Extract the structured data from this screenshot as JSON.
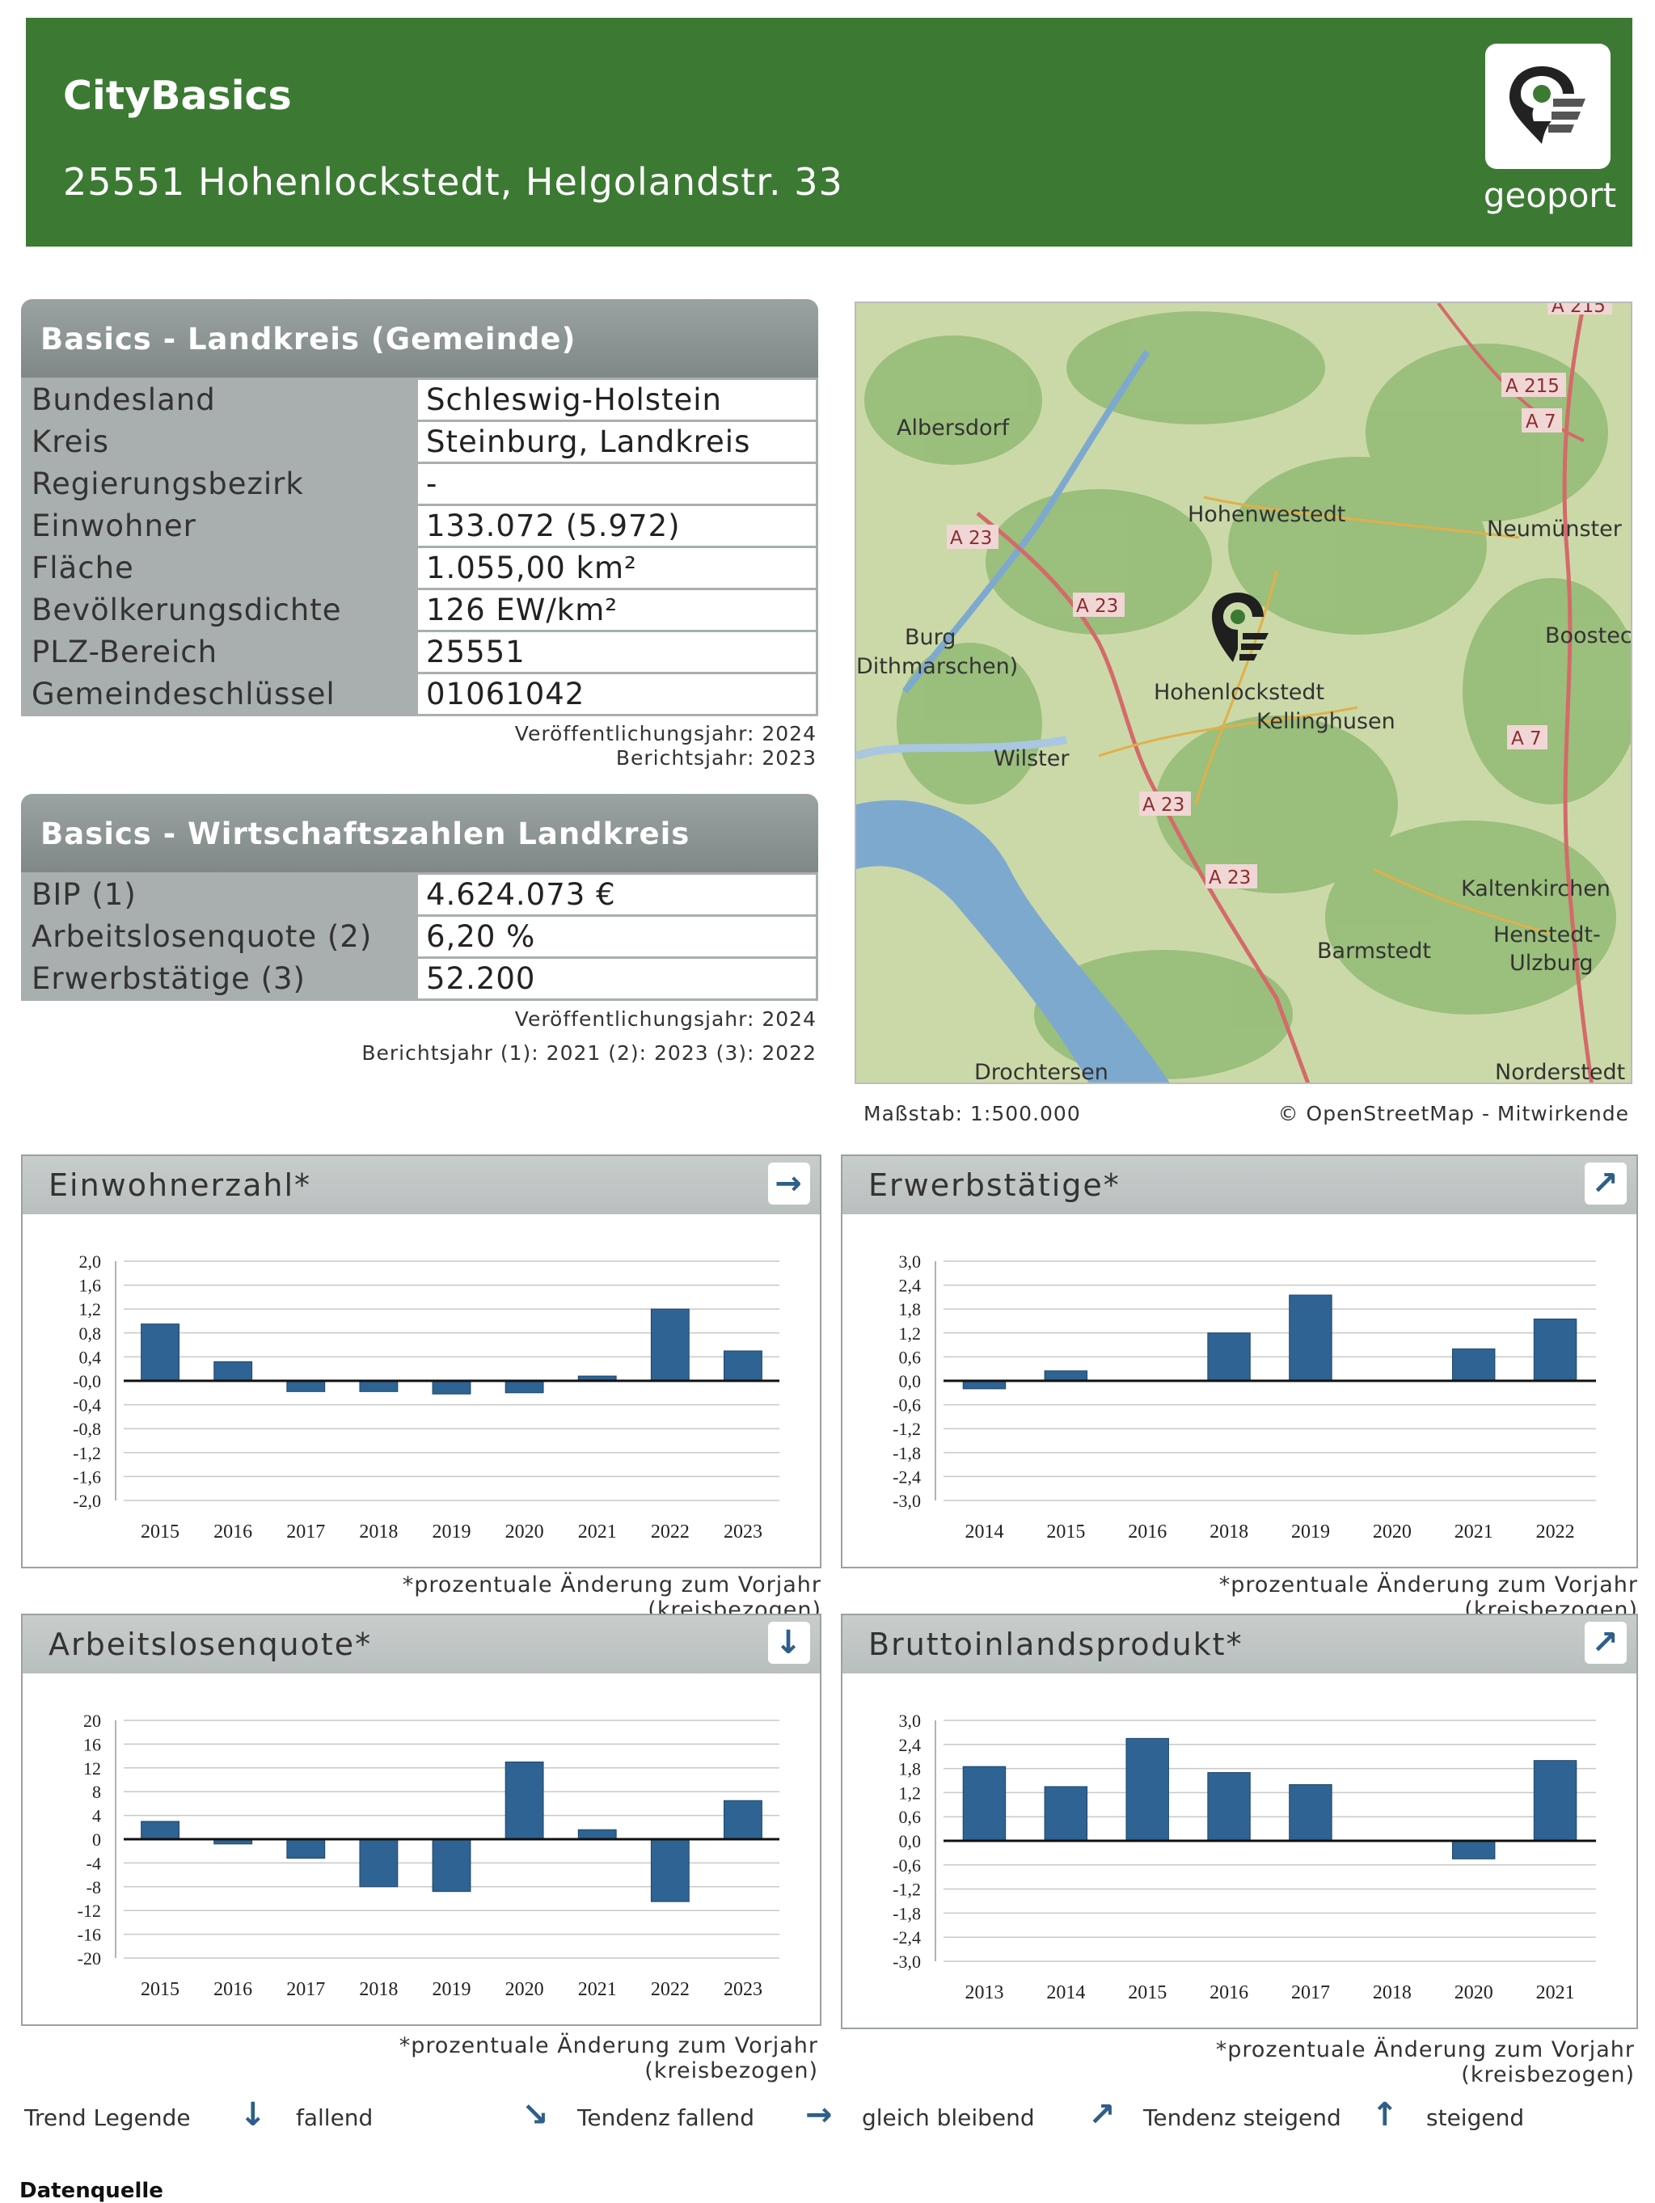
{
  "header": {
    "app_name": "CityBasics",
    "address": "25551 Hohenlockstedt, Helgolandstr. 33",
    "logo_text": "geoport"
  },
  "basics": {
    "title": "Basics - Landkreis (Gemeinde)",
    "rows": [
      {
        "label": "Bundesland",
        "value": "Schleswig-Holstein"
      },
      {
        "label": "Kreis",
        "value": "Steinburg, Landkreis"
      },
      {
        "label": "Regierungsbezirk",
        "value": "-"
      },
      {
        "label": "Einwohner",
        "value": "133.072 (5.972)"
      },
      {
        "label": "Fläche",
        "value": "1.055,00 km²"
      },
      {
        "label": "Bevölkerungsdichte",
        "value": "126 EW/km²"
      },
      {
        "label": "PLZ-Bereich",
        "value": "25551"
      },
      {
        "label": "Gemeindeschlüssel",
        "value": "01061042"
      }
    ],
    "pub_year": "Veröffentlichungsjahr: 2024",
    "report_year": "Berichtsjahr: 2023"
  },
  "economy": {
    "title": "Basics - Wirtschaftszahlen Landkreis",
    "rows": [
      {
        "label": "BIP (1)",
        "value": "4.624.073 €"
      },
      {
        "label": "Arbeitslosenquote (2)",
        "value": "6,20 %"
      },
      {
        "label": "Erwerbstätige (3)",
        "value": "52.200"
      }
    ],
    "pub_year": "Veröffentlichungsjahr: 2024",
    "report_year": "Berichtsjahr (1): 2021 (2): 2023 (3): 2022"
  },
  "map": {
    "places": [
      "Albersdorf",
      "Hohenwestedt",
      "Neumünster",
      "Burg",
      "Dithmarschen)",
      "Boostec",
      "Hohenlockstedt",
      "Kellinghusen",
      "Wilster",
      "Kaltenkirchen",
      "Henstedt-",
      "Ulzburg",
      "Barmstedt",
      "Drochtersen",
      "Norderstedt"
    ],
    "roads": [
      "A 215",
      "A 215",
      "A 7",
      "A 23",
      "A 23",
      "A 7",
      "A 23",
      "A 23"
    ],
    "scale": "Maßstab: 1:500.000",
    "attribution": "© OpenStreetMap - Mitwirkende"
  },
  "footnote": "*prozentuale Änderung zum Vorjahr (kreisbezogen)",
  "chart_data": [
    {
      "type": "bar",
      "title": "Einwohnerzahl*",
      "trend": "gleich bleibend",
      "trend_icon": "→",
      "categories": [
        "2015",
        "2016",
        "2017",
        "2018",
        "2019",
        "2020",
        "2021",
        "2022",
        "2023"
      ],
      "values": [
        0.95,
        0.32,
        -0.18,
        -0.18,
        -0.22,
        -0.2,
        0.08,
        1.2,
        0.5
      ],
      "yticks": [
        "2,0",
        "1,6",
        "1,2",
        "0,8",
        "0,4",
        "-0,0",
        "-0,4",
        "-0,8",
        "-1,2",
        "-1,6",
        "-2,0"
      ],
      "ylim": [
        -2.0,
        2.0
      ]
    },
    {
      "type": "bar",
      "title": "Erwerbstätige*",
      "trend": "Tendenz steigend",
      "trend_icon": "↗",
      "categories": [
        "2014",
        "2015",
        "2016",
        "2018",
        "2019",
        "2020",
        "2021",
        "2022"
      ],
      "values": [
        -0.2,
        0.25,
        0.0,
        1.2,
        2.15,
        0.0,
        0.8,
        1.55
      ],
      "yticks": [
        "3,0",
        "2,4",
        "1,8",
        "1,2",
        "0,6",
        "0,0",
        "-0,6",
        "-1,2",
        "-1,8",
        "-2,4",
        "-3,0"
      ],
      "ylim": [
        -3.0,
        3.0
      ]
    },
    {
      "type": "bar",
      "title": "Arbeitslosenquote*",
      "trend": "fallend",
      "trend_icon": "↓",
      "categories": [
        "2015",
        "2016",
        "2017",
        "2018",
        "2019",
        "2020",
        "2021",
        "2022",
        "2023"
      ],
      "values": [
        3.0,
        -0.8,
        -3.2,
        -8.0,
        -8.8,
        13.0,
        1.6,
        -10.5,
        6.5
      ],
      "yticks": [
        "20",
        "16",
        "12",
        "8",
        "4",
        "0",
        "-4",
        "-8",
        "-12",
        "-16",
        "-20"
      ],
      "ylim": [
        -20,
        20
      ]
    },
    {
      "type": "bar",
      "title": "Bruttoinlandsprodukt*",
      "trend": "Tendenz steigend",
      "trend_icon": "↗",
      "categories": [
        "2013",
        "2014",
        "2015",
        "2016",
        "2017",
        "2018",
        "2020",
        "2021"
      ],
      "values": [
        1.85,
        1.35,
        2.55,
        1.7,
        1.4,
        0.0,
        -0.45,
        2.0
      ],
      "yticks": [
        "3,0",
        "2,4",
        "1,8",
        "1,2",
        "0,6",
        "0,0",
        "-0,6",
        "-1,2",
        "-1,8",
        "-2,4",
        "-3,0"
      ],
      "ylim": [
        -3.0,
        3.0
      ]
    }
  ],
  "legend": {
    "title": "Trend Legende",
    "items": [
      {
        "icon": "↓",
        "label": "fallend"
      },
      {
        "icon": "↘",
        "label": "Tendenz fallend"
      },
      {
        "icon": "→",
        "label": "gleich bleibend"
      },
      {
        "icon": "↗",
        "label": "Tendenz steigend"
      },
      {
        "icon": "↑",
        "label": "steigend"
      }
    ]
  },
  "source_label": "Datenquelle",
  "colors": {
    "header_green": "#3c7a34",
    "bar_blue": "#2e6393",
    "panel_grey": "#a8afae"
  }
}
